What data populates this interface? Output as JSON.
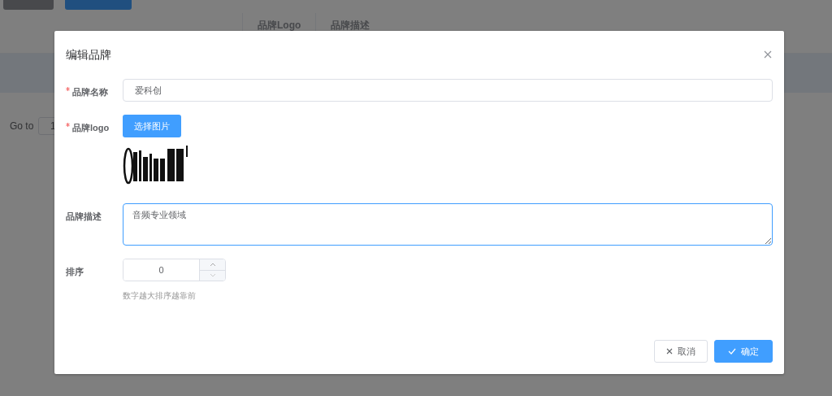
{
  "background_page": {
    "table": {
      "columns": [
        "品牌Logo",
        "品牌描述"
      ]
    },
    "pagination": {
      "goto_label": "Go to",
      "page_value": "1"
    }
  },
  "dialog": {
    "title": "编辑品牌",
    "fields": [
      {
        "kind": "text",
        "label": "品牌名称",
        "required": true,
        "value": "爱科创"
      },
      {
        "kind": "upload",
        "label": "品牌logo",
        "required": true,
        "button": "选择图片"
      },
      {
        "kind": "textarea",
        "label": "品牌描述",
        "required": false,
        "value": "音频专业领域",
        "focused": true
      },
      {
        "kind": "number",
        "label": "排序",
        "required": false,
        "value": "0",
        "hint": "数字越大排序越靠前"
      }
    ],
    "buttons": [
      {
        "kind": "cancel",
        "label": "取消"
      },
      {
        "kind": "confirm",
        "label": "确定"
      }
    ]
  }
}
